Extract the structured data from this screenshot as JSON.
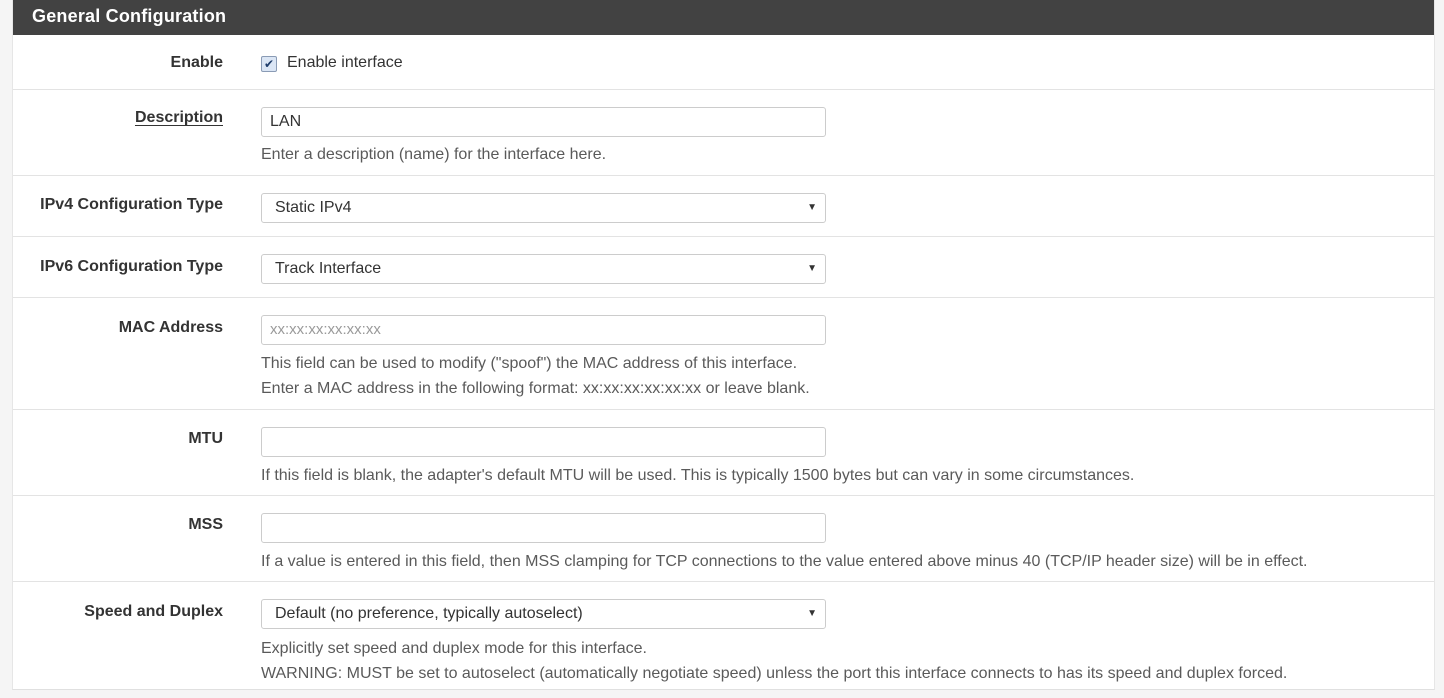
{
  "panel": {
    "title": "General Configuration"
  },
  "rows": {
    "enable": {
      "label": "Enable",
      "checkbox_checked": true,
      "checkbox_label": "Enable interface"
    },
    "description": {
      "label": "Description",
      "value": "LAN",
      "help": "Enter a description (name) for the interface here."
    },
    "ipv4": {
      "label": "IPv4 Configuration Type",
      "selected": "Static IPv4"
    },
    "ipv6": {
      "label": "IPv6 Configuration Type",
      "selected": "Track Interface"
    },
    "mac": {
      "label": "MAC Address",
      "placeholder": "xx:xx:xx:xx:xx:xx",
      "value": "",
      "help_line1": "This field can be used to modify (\"spoof\") the MAC address of this interface.",
      "help_line2": "Enter a MAC address in the following format: xx:xx:xx:xx:xx:xx or leave blank."
    },
    "mtu": {
      "label": "MTU",
      "value": "",
      "help": "If this field is blank, the adapter's default MTU will be used. This is typically 1500 bytes but can vary in some circumstances."
    },
    "mss": {
      "label": "MSS",
      "value": "",
      "help": "If a value is entered in this field, then MSS clamping for TCP connections to the value entered above minus 40 (TCP/IP header size) will be in effect."
    },
    "speed": {
      "label": "Speed and Duplex",
      "selected": "Default (no preference, typically autoselect)",
      "help_line1": "Explicitly set speed and duplex mode for this interface.",
      "help_line2": "WARNING: MUST be set to autoselect (automatically negotiate speed) unless the port this interface connects to has its speed and duplex forced."
    }
  },
  "icons": {
    "select_caret": "▼",
    "checkmark": "✔"
  },
  "colors": {
    "heading_bg": "#424242",
    "heading_text": "#ffffff",
    "help_text": "#5a5a5a",
    "row_border": "#e3e3e3"
  }
}
